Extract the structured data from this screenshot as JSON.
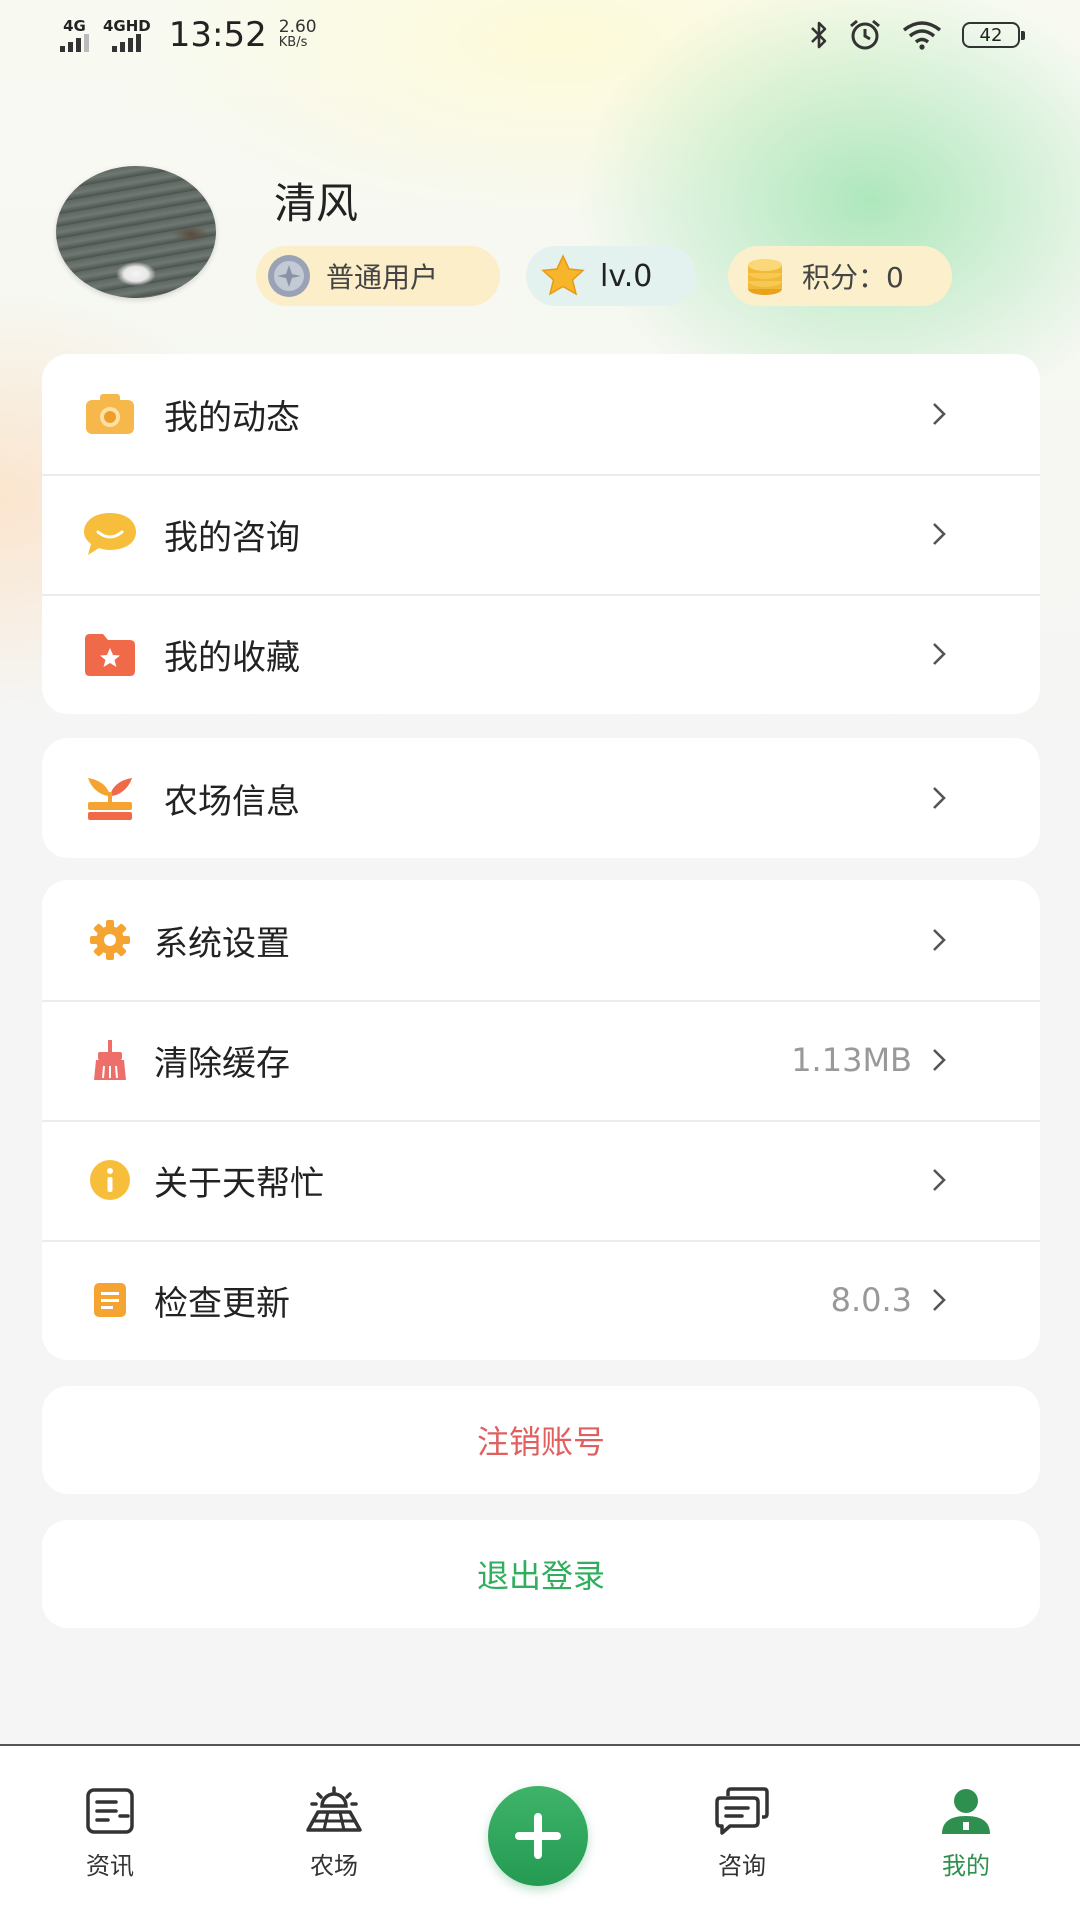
{
  "status_bar": {
    "signal1": "4G",
    "signal2": "4GHD",
    "time": "13:52",
    "net_speed": "2.60",
    "net_unit": "KB/s",
    "battery": "42"
  },
  "profile": {
    "username": "清风",
    "user_type": "普通用户",
    "level": "lv.0",
    "points": "积分：0"
  },
  "menu_group1": [
    {
      "label": "我的动态",
      "icon": "camera-icon"
    },
    {
      "label": "我的咨询",
      "icon": "chat-bubble-icon"
    },
    {
      "label": "我的收藏",
      "icon": "star-folder-icon"
    }
  ],
  "menu_group2": [
    {
      "label": "农场信息",
      "icon": "farm-icon"
    }
  ],
  "menu_group3": [
    {
      "label": "系统设置",
      "value": "",
      "icon": "gear-icon"
    },
    {
      "label": "清除缓存",
      "value": "1.13MB",
      "icon": "broom-icon"
    },
    {
      "label": "关于天帮忙",
      "value": "",
      "icon": "info-icon"
    },
    {
      "label": "检查更新",
      "value": "8.0.3",
      "icon": "document-icon"
    }
  ],
  "actions": {
    "deactivate": "注销账号",
    "logout": "退出登录"
  },
  "tabbar": {
    "tabs": [
      {
        "label": "资讯",
        "icon": "news-icon"
      },
      {
        "label": "农场",
        "icon": "farm-sun-icon"
      },
      {
        "label": "咨询",
        "icon": "chat-icon"
      },
      {
        "label": "我的",
        "icon": "person-icon"
      }
    ],
    "active_index": 3
  },
  "colors": {
    "accent_green": "#2fae5e",
    "danger_red": "#e06060",
    "icon_orange": "#f5a431"
  }
}
